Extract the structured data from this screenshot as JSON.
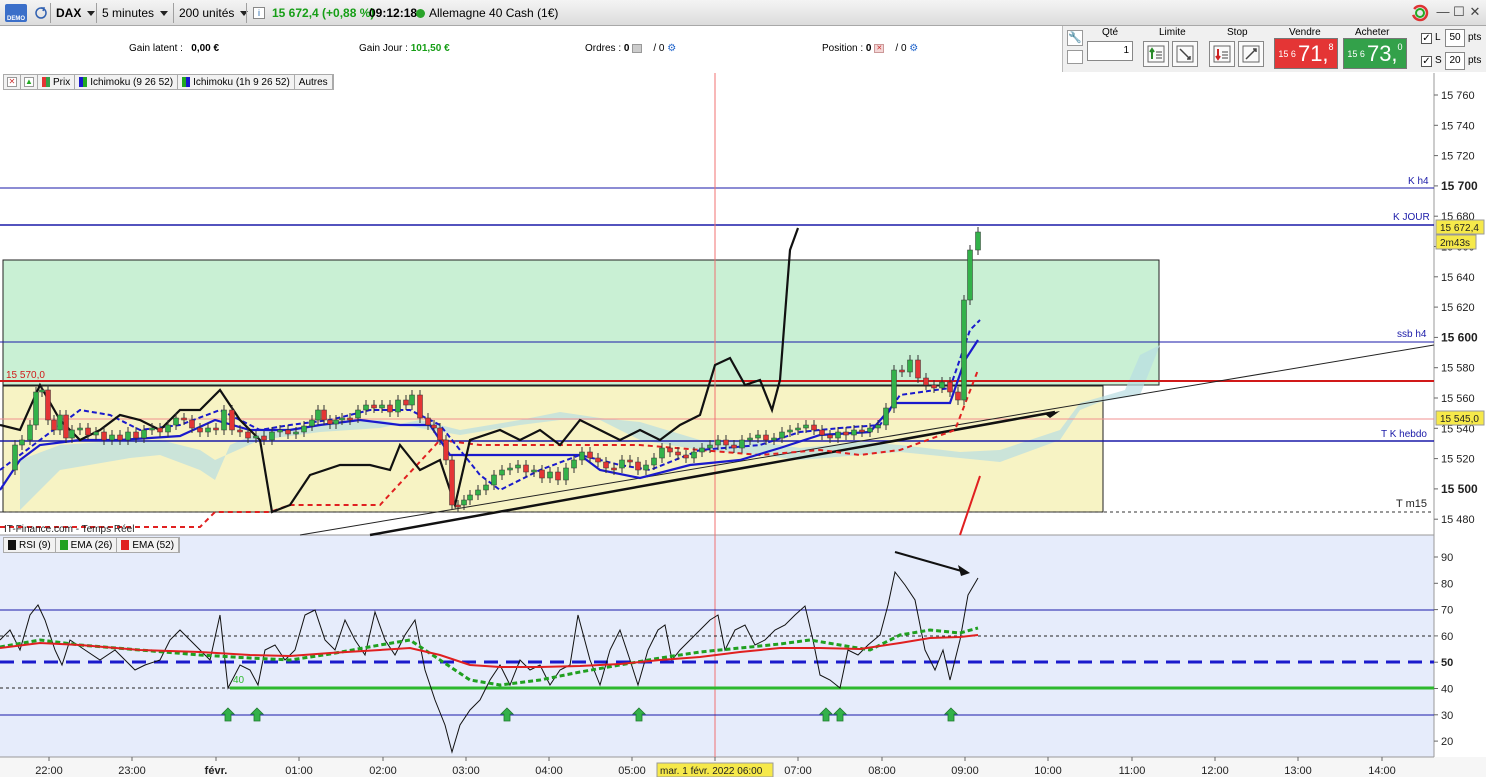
{
  "toolbar": {
    "demo": "DEMO",
    "instrument": "DAX",
    "timeframe": "5 minutes",
    "units": "200 unités",
    "info_icon": "i",
    "price_change": "15 672,4 (+0,88 %)",
    "time": "09:12:18",
    "market": "Allemagne 40 Cash (1€)"
  },
  "stats": {
    "gain_latent_label": "Gain latent :",
    "gain_latent_value": "0,00 €",
    "gain_jour_label": "Gain Jour :",
    "gain_jour_value": "101,50 €",
    "ordres_label": "Ordres :",
    "ordres_value": "0",
    "ordres_sep": "/ 0",
    "position_label": "Position :",
    "position_value": "0",
    "position_sep": "/ 0"
  },
  "order_panel": {
    "qty_label": "Qté",
    "qty_value": "1",
    "limite_label": "Limite",
    "stop_label": "Stop",
    "vendre_label": "Vendre",
    "vendre_prefix": "15 6",
    "vendre_big": "71,",
    "vendre_sup": "8",
    "acheter_label": "Acheter",
    "acheter_prefix": "15 6",
    "acheter_big": "73,",
    "acheter_sup": "0",
    "l_label": "L",
    "l_value": "50",
    "s_label": "S",
    "s_value": "20",
    "pts": "pts"
  },
  "legend": {
    "prix": "Prix",
    "ichimoku1": "Ichimoku (9 26 52)",
    "ichimoku2": "Ichimoku (1h 9 26 52)",
    "autres": "Autres"
  },
  "legend2": {
    "rsi": "RSI (9)",
    "ema26": "EMA (26)",
    "ema52": "EMA (52)"
  },
  "chart_labels": {
    "level_15570": "15 570,0",
    "k_h4": "K h4",
    "k_jour": "K JOUR",
    "ssb_h4": "ssb h4",
    "tk_hebdo": "T K hebdo",
    "t_m15": "T m15",
    "source": "IT-Finance.com - Temps Réel",
    "current_price": "15 672,4",
    "countdown": "2m43s",
    "price_15545": "15 545,0",
    "rsi_40": "40",
    "date_label": "mar. 1 févr. 2022 06:00"
  },
  "price_axis": [
    "15 760",
    "15 740",
    "15 720",
    "15 700",
    "15 680",
    "15 660",
    "15 640",
    "15 620",
    "15 600",
    "15 580",
    "15 560",
    "15 540",
    "15 520",
    "15 500",
    "15 480"
  ],
  "rsi_axis": [
    "90",
    "80",
    "70",
    "60",
    "50",
    "40",
    "30",
    "20"
  ],
  "time_axis": [
    "22:00",
    "23:00",
    "févr.",
    "01:00",
    "02:00",
    "03:00",
    "04:00",
    "05:00",
    "06:00",
    "07:00",
    "08:00",
    "09:00",
    "10:00",
    "11:00",
    "12:00",
    "13:00",
    "14:00"
  ],
  "colors": {
    "sell": "#e43535",
    "buy": "#33a14a",
    "blue_line": "#1a1aa8",
    "red_line": "#d11919",
    "green_zone": "#c9f0d4",
    "yellow_zone": "#f7f3c4",
    "rsi_bg": "#e6ecfb"
  }
}
